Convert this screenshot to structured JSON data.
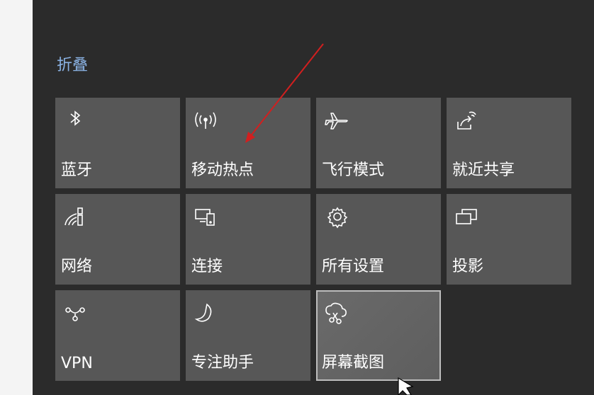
{
  "collapse_label": "折叠",
  "tiles": [
    {
      "label": "蓝牙",
      "icon": "bluetooth-icon"
    },
    {
      "label": "移动热点",
      "icon": "mobile-hotspot-icon"
    },
    {
      "label": "飞行模式",
      "icon": "airplane-icon"
    },
    {
      "label": "就近共享",
      "icon": "nearby-share-icon"
    },
    {
      "label": "网络",
      "icon": "network-icon"
    },
    {
      "label": "连接",
      "icon": "connect-icon"
    },
    {
      "label": "所有设置",
      "icon": "gear-icon"
    },
    {
      "label": "投影",
      "icon": "project-icon"
    },
    {
      "label": "VPN",
      "icon": "vpn-icon"
    },
    {
      "label": "专注助手",
      "icon": "moon-icon"
    },
    {
      "label": "屏幕截图",
      "icon": "snip-icon",
      "selected": true
    }
  ],
  "colors": {
    "panel_bg": "#2b2b2b",
    "tile_bg": "#575757",
    "accent_link": "#8cb4e6",
    "annotation_arrow": "#d21f1f"
  }
}
